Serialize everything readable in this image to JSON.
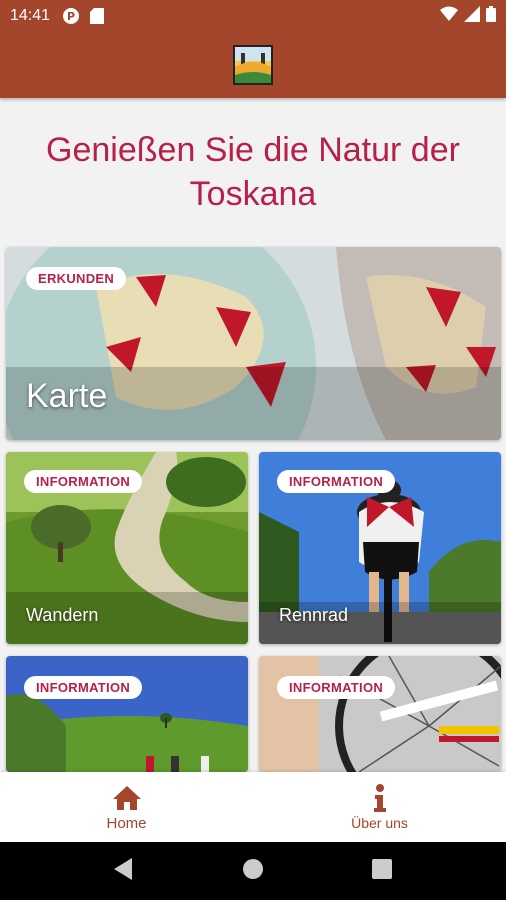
{
  "status_bar": {
    "time": "14:41",
    "icons": [
      "notification-icon",
      "sd-card-icon",
      "wifi-icon",
      "signal-icon",
      "battery-icon"
    ]
  },
  "app_bar": {
    "logo": "toscana-logo"
  },
  "headline": "Genießen Sie die Natur der Toskana",
  "cards": [
    {
      "badge": "ERKUNDEN",
      "title": "Karte"
    },
    {
      "badge": "INFORMATION",
      "title": "Wandern"
    },
    {
      "badge": "INFORMATION",
      "title": "Rennrad"
    },
    {
      "badge": "INFORMATION",
      "title": ""
    },
    {
      "badge": "INFORMATION",
      "title": ""
    }
  ],
  "bottom_nav": [
    {
      "label": "Home",
      "icon": "home-icon"
    },
    {
      "label": "Über uns",
      "icon": "info-icon"
    }
  ],
  "colors": {
    "accent": "#a3462c",
    "headline": "#b5214a",
    "badge_text": "#b5214a"
  }
}
